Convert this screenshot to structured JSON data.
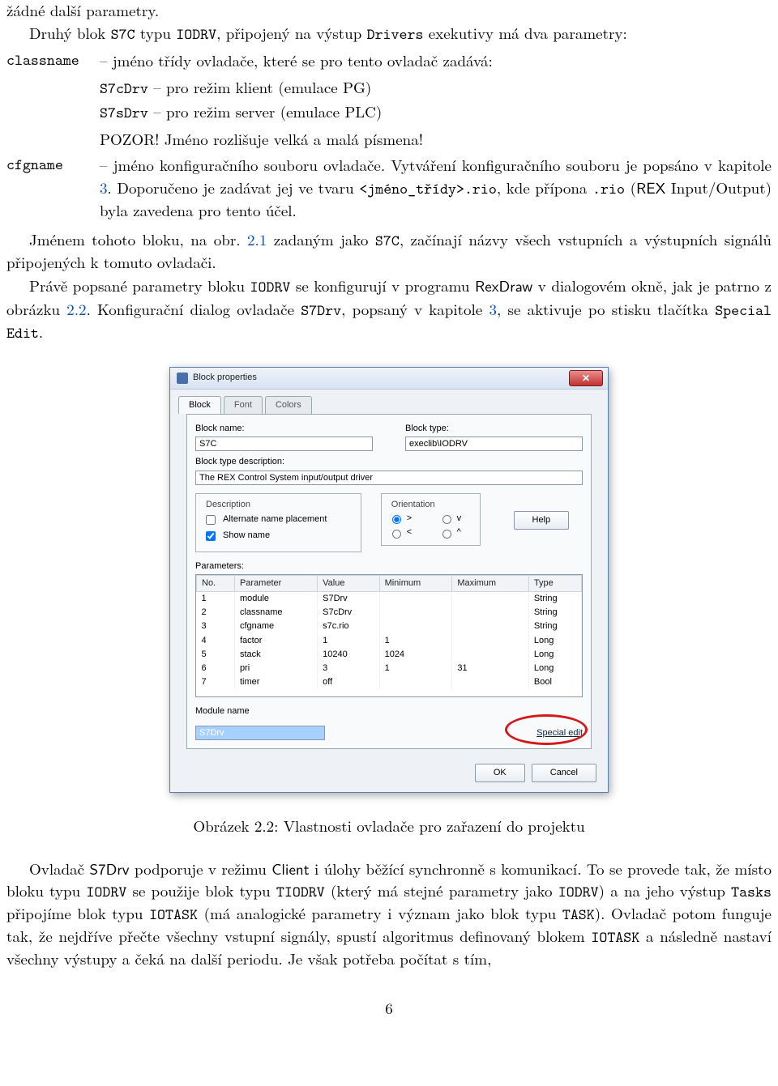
{
  "para": {
    "l1": "žádné další parametry.",
    "l2a": "Druhý blok ",
    "l2b": " typu ",
    "l2c": ", připojený na výstup ",
    "l2d": " exekutivy má dva parametry:"
  },
  "tokens": {
    "S7C": "S7C",
    "IODRV": "IODRV",
    "Drivers": "Drivers",
    "classname": "classname",
    "S7cDrv": "S7cDrv",
    "S7sDrv": "S7sDrv",
    "cfgname": "cfgname",
    "jmeno_tridy": "<jméno_třídy>.rio",
    "rio": ".rio",
    "RexDraw": "RexDraw",
    "S7Drv_sf": "S7Drv",
    "Client": "Client",
    "TIODRV": "TIODRV",
    "Tasks": "Tasks",
    "IOTASK": "IOTASK",
    "TASK": "TASK",
    "SpecialEdit": "Special Edit",
    "S7Drv": "S7Drv",
    "REX": "REX"
  },
  "dl1": {
    "classname_body": " – jméno třídy ovladače, které se pro tento ovladač zadává:",
    "sub1a": " – pro režim klient (emulace PG)",
    "sub2a": " – pro režim server (emulace PLC)",
    "pozor": "POZOR! Jméno rozlišuje velká a malá písmena!",
    "cfgname_body1": " – jméno konfiguračního souboru ovladače. Vytváření konfiguračního souboru je popsáno v kapitole ",
    "cfgname_ch3": "3",
    "cfgname_body2": ". Doporučeno je zadávat jej ve tvaru ",
    "cfgname_body3": ", kde přípona ",
    "cfgname_body4": " (",
    "cfgname_body5": " Input/Output) byla zavedena pro tento účel."
  },
  "mid": {
    "p3a": "Jménem tohoto bloku, na obr. ",
    "p3ref1": "2.1",
    "p3b": " zadaným jako ",
    "p3c": ", začínají názvy všech vstupních a výstupních signálů připojených k tomuto ovladači.",
    "p4a": "Právě popsané parametry bloku ",
    "p4b": " se konfigurují v programu ",
    "p4c": " v dialogovém okně, jak je patrno z obrázku ",
    "p4ref2": "2.2",
    "p4d": ". Konfigurační dialog ovladače ",
    "p4e": ", popsaný v kapitole ",
    "p4ref3": "3",
    "p4f": ", se aktivuje po stisku tlačítka "
  },
  "dialog": {
    "title": "Block properties",
    "tabs": {
      "block": "Block",
      "font": "Font",
      "colors": "Colors"
    },
    "bn_lbl": "Block name:",
    "bn_val": "S7C",
    "bt_lbl": "Block type:",
    "bt_val": "execlib\\IODRV",
    "btd_lbl": "Block type description:",
    "btd_val": "The REX Control System input/output driver",
    "desc_legend": "Description",
    "cb_alt": "Alternate name placement",
    "cb_show": "Show name",
    "ori_legend": "Orientation",
    "r_right": ">",
    "r_down": "v",
    "r_left": "<",
    "r_up": "^",
    "help": "Help",
    "params_lbl": "Parameters:",
    "th": {
      "no": "No.",
      "param": "Parameter",
      "value": "Value",
      "min": "Minimum",
      "max": "Maximum",
      "type": "Type"
    },
    "rows": [
      {
        "no": "1",
        "param": "module",
        "value": "S7Drv",
        "min": "",
        "max": "",
        "type": "String"
      },
      {
        "no": "2",
        "param": "classname",
        "value": "S7cDrv",
        "min": "",
        "max": "",
        "type": "String"
      },
      {
        "no": "3",
        "param": "cfgname",
        "value": "s7c.rio",
        "min": "",
        "max": "",
        "type": "String"
      },
      {
        "no": "4",
        "param": "factor",
        "value": "1",
        "min": "1",
        "max": "",
        "type": "Long"
      },
      {
        "no": "5",
        "param": "stack",
        "value": "10240",
        "min": "1024",
        "max": "",
        "type": "Long"
      },
      {
        "no": "6",
        "param": "pri",
        "value": "3",
        "min": "1",
        "max": "31",
        "type": "Long"
      },
      {
        "no": "7",
        "param": "timer",
        "value": "off",
        "min": "",
        "max": "",
        "type": "Bool"
      }
    ],
    "mod_lbl": "Module name",
    "mod_val": "S7Drv",
    "special": "Special edit",
    "ok": "OK",
    "cancel": "Cancel"
  },
  "caption": "Obrázek 2.2: Vlastnosti ovladače pro zařazení do projektu",
  "tail": {
    "a": "Ovladač ",
    "b": " podporuje v režimu ",
    "c": " i úlohy běžící synchronně s komunikací. To se provede tak, že místo bloku typu ",
    "d": " se použije blok typu ",
    "e": " (který má stejné parametry jako ",
    "f": ") a na jeho výstup ",
    "g": " připojíme blok typu ",
    "h": " (má analogické parametry i význam jako blok typu ",
    "i": "). Ovladač potom funguje tak, že nejdříve přečte všechny vstupní signály, spustí algoritmus definovaný blokem ",
    "j": " a následně nastaví všechny výstupy a čeká na další periodu. Je však potřeba počítat s tím,"
  },
  "pagenum": "6"
}
